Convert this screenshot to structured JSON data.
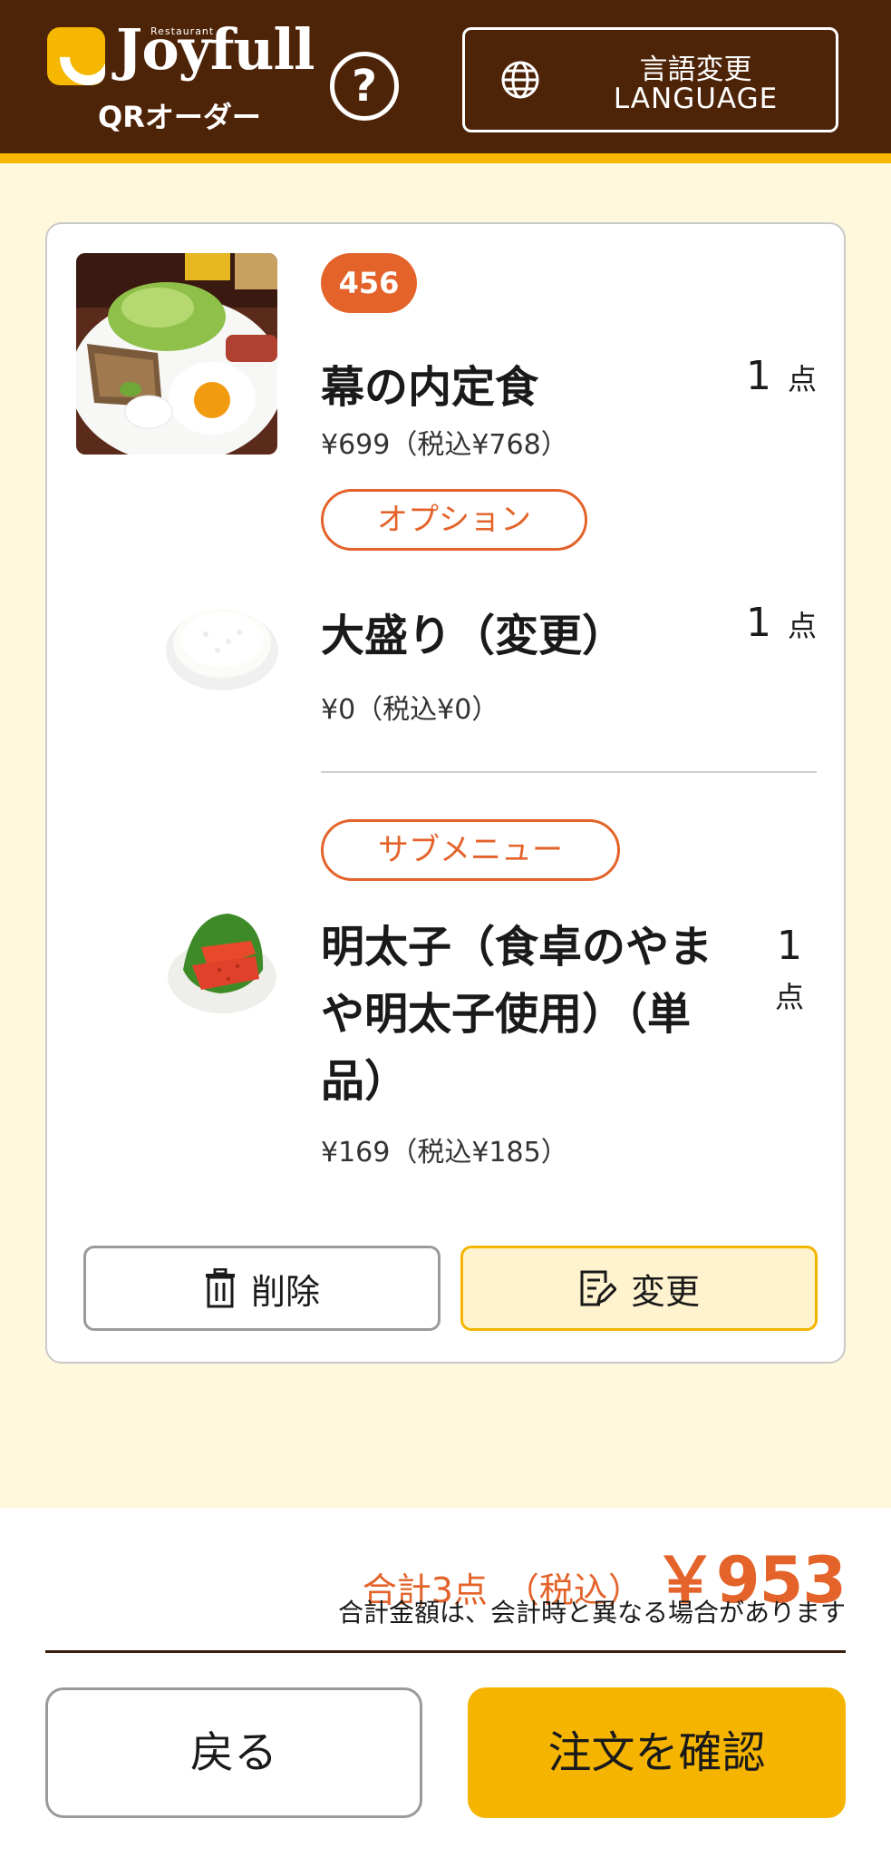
{
  "header": {
    "logo_small": "Restaurant",
    "logo_text": "Joyfull",
    "logo_sub": "QRオーダー",
    "help_symbol": "?",
    "lang_line1": "言語変更",
    "lang_line2": "LANGUAGE"
  },
  "order": {
    "badge": "456",
    "main_item": {
      "name": "幕の内定食",
      "qty": "1",
      "unit": "点",
      "price": "¥699（税込¥768）"
    },
    "option_label": "オプション",
    "option_item": {
      "name": "大盛り（変更）",
      "qty": "1",
      "unit": "点",
      "price": "¥0（税込¥0）"
    },
    "submenu_label": "サブメニュー",
    "submenu_item": {
      "name_lines": [
        "明太子（食卓のやま",
        "や明太子使用）（単",
        "品）"
      ],
      "qty": "1",
      "unit": "点",
      "price": "¥169（税込¥185）"
    },
    "delete_label": "削除",
    "edit_label": "変更"
  },
  "footer": {
    "total_label": "合計3点　（税込）",
    "total_amount": "￥953",
    "note": "合計金額は、会計時と異なる場合があります",
    "back_label": "戻る",
    "confirm_label": "注文を確認"
  },
  "colors": {
    "header_bg": "#4E2408",
    "accent_yellow": "#F6B700",
    "accent_orange": "#E3632A",
    "page_bg": "#FFF8DC"
  },
  "icons": {
    "help": "help-circle-icon",
    "language": "globe-icon",
    "delete": "trash-icon",
    "edit": "edit-note-icon"
  }
}
